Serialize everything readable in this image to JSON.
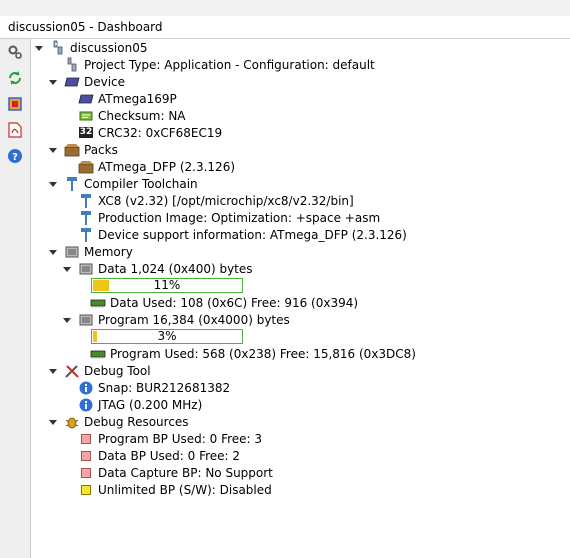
{
  "window": {
    "title": "discussion05 - Dashboard"
  },
  "toolbar": {
    "buttons": [
      "settings-icon",
      "refresh-icon",
      "chip-icon",
      "pdf-icon",
      "help-icon"
    ]
  },
  "tree": {
    "project": {
      "name": "discussion05",
      "info": "Project Type: Application - Configuration: default"
    },
    "device": {
      "label": "Device",
      "name": "ATmega169P",
      "checksum": "Checksum: NA",
      "crc": "CRC32: 0xCF68EC19",
      "crc_badge": "32"
    },
    "packs": {
      "label": "Packs",
      "item": "ATmega_DFP (2.3.126)"
    },
    "toolchain": {
      "label": "Compiler Toolchain",
      "compiler": "XC8 (v2.32) [/opt/microchip/xc8/v2.32/bin]",
      "production": "Production Image: Optimization: +space +asm",
      "support": "Device support information: ATmega_DFP (2.3.126)"
    },
    "memory": {
      "label": "Memory",
      "data": {
        "label": "Data 1,024 (0x400) bytes",
        "percent": "11%",
        "fraction": 0.11,
        "used": "Data Used: 108 (0x6C) Free: 916 (0x394)"
      },
      "program": {
        "label": "Program 16,384 (0x4000) bytes",
        "percent": "3%",
        "fraction": 0.03,
        "used": "Program Used: 568 (0x238) Free: 15,816 (0x3DC8)"
      }
    },
    "debug_tool": {
      "label": "Debug Tool",
      "snap": "Snap: BUR212681382",
      "jtag": "JTAG (0.200 MHz)"
    },
    "debug_resources": {
      "label": "Debug Resources",
      "program_bp": "Program BP Used: 0  Free: 3",
      "data_bp": "Data BP Used: 0  Free: 2",
      "data_capture": "Data Capture BP: No Support",
      "unlimited": "Unlimited BP (S/W): Disabled"
    }
  },
  "colors": {
    "progress_border": "#49b23a",
    "progress_fill": "#f0c419",
    "bp_red": "#f4a6a6",
    "bp_yellow": "#f6e52a"
  }
}
